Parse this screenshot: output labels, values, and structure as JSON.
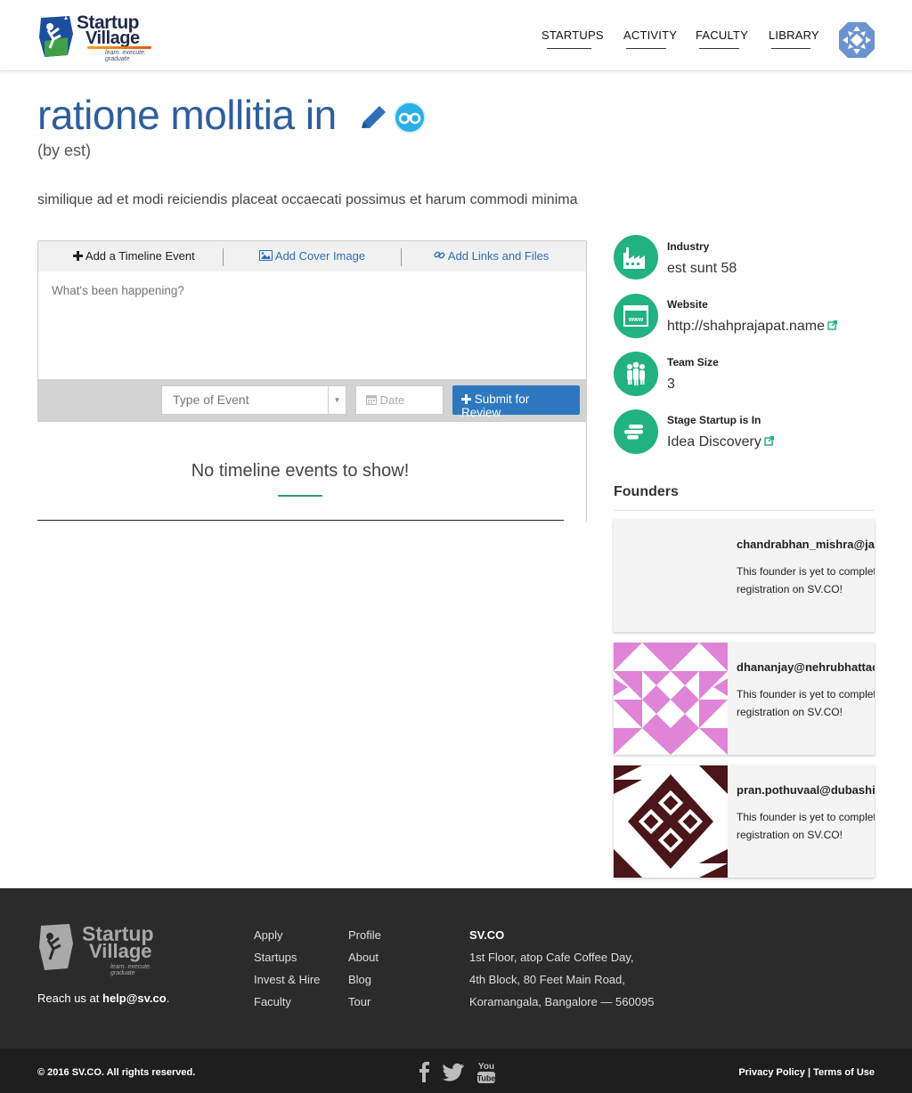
{
  "header": {
    "logo_line1": "Startup",
    "logo_line2": "Village",
    "logo_tagline": "learn. execute. graduate",
    "nav": [
      "STARTUPS",
      "ACTIVITY",
      "FACULTY",
      "LIBRARY"
    ]
  },
  "startup": {
    "name": "ratione mollitia in",
    "byline": "(by est)",
    "about": "similique ad et modi reiciendis placeat occaecati possimus et harum commodi minima"
  },
  "composer": {
    "tab_event": "Add a Timeline Event",
    "tab_cover": "Add Cover Image",
    "tab_links": "Add Links and Files",
    "placeholder": "What's been happening?",
    "event_type_placeholder": "Type of Event",
    "date_placeholder": "Date",
    "submit_label": "Submit for Review"
  },
  "timeline": {
    "empty_message": "No timeline events to show!"
  },
  "info": [
    {
      "label": "Industry",
      "value": "est sunt 58",
      "icon": "factory-icon"
    },
    {
      "label": "Website",
      "value": "http://shahprajapat.name",
      "icon": "www-icon"
    },
    {
      "label": "Team Size",
      "value": "3",
      "icon": "team-icon"
    },
    {
      "label": "Stage Startup is In",
      "value": "Idea Discovery",
      "icon": "stage-icon"
    }
  ],
  "founders": {
    "heading": "Founders",
    "list": [
      {
        "email": "chandrabhan_mishra@jacobi.info",
        "note_line1": "This founder is yet to complete",
        "note_line2": "registration on SV.CO!"
      },
      {
        "email": "dhananjay@nehrubhattacharya.com",
        "note_line1": "This founder is yet to complete",
        "note_line2": "registration on SV.CO!"
      },
      {
        "email": "pran.pothuvaal@dubashi.info",
        "note_line1": "This founder is yet to complete",
        "note_line2": "registration on SV.CO!"
      }
    ]
  },
  "footer": {
    "logo_line1": "Startup",
    "logo_line2": "Village",
    "logo_tagline": "learn. execute. graduate",
    "reach_prefix": "Reach us at ",
    "reach_email": "help@sv.co",
    "reach_suffix": ".",
    "col1": [
      "Apply",
      "Startups",
      "Invest & Hire",
      "Faculty"
    ],
    "col2": [
      "Profile",
      "About",
      "Blog",
      "Tour"
    ],
    "address_heading": "SV.CO",
    "address": [
      "1st Floor, atop Cafe Coffee Day,",
      "4th Block, 80 Feet Main Road,",
      "Koramangala, Bangalore — 560095"
    ],
    "copyright": "© 2016 SV.CO. All rights reserved.",
    "privacy": "Privacy Policy",
    "separator": " | ",
    "terms": "Terms of Use",
    "youtube_label": "You Tube"
  },
  "colors": {
    "brand_blue": "#2f5e9e",
    "accent_green": "#22b282",
    "submit_blue": "#2e78c0",
    "follow_blue": "#2ab0e8",
    "footer_dark": "#2b2b2b"
  }
}
